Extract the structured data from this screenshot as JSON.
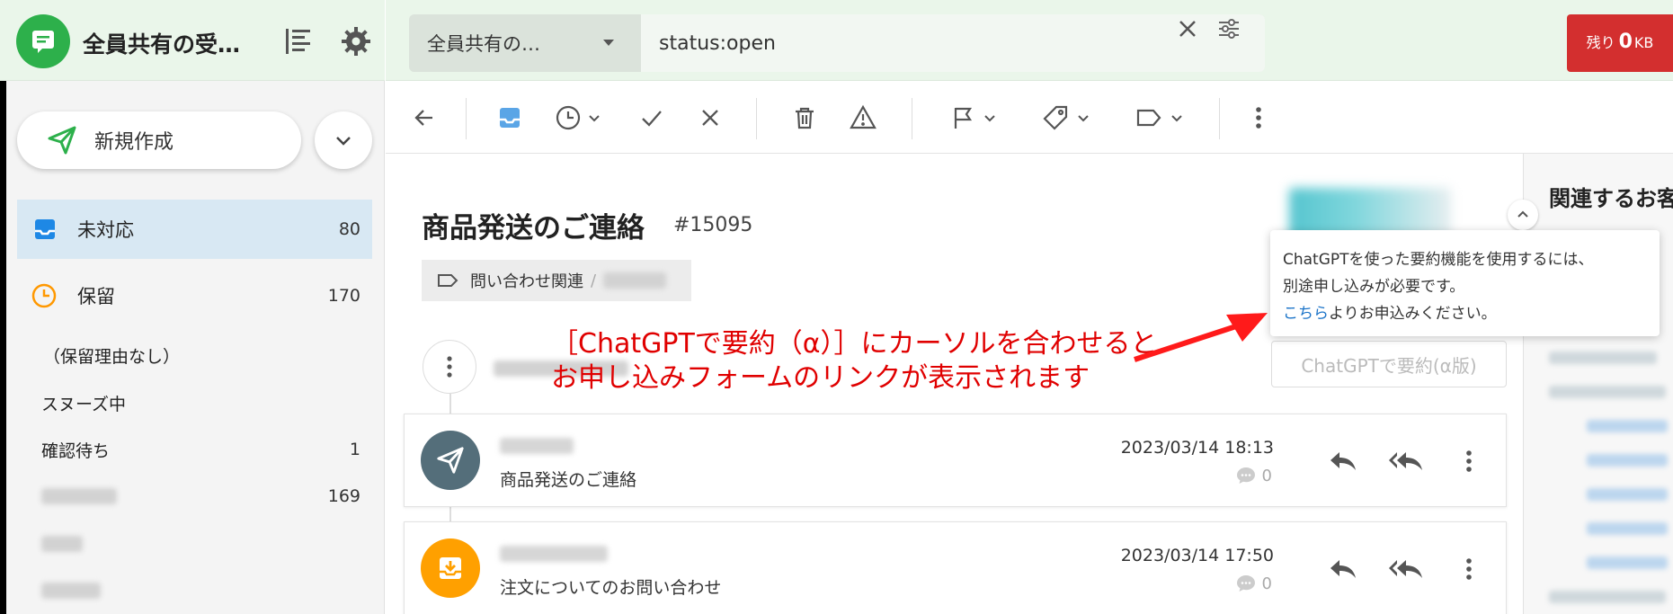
{
  "sidebar": {
    "workspace_title": "全員共有の受…",
    "compose_label": "新規作成",
    "nav": [
      {
        "label": "未対応",
        "count": "80"
      },
      {
        "label": "保留",
        "count": "170"
      }
    ],
    "sub": [
      {
        "label": "（保留理由なし）",
        "count": ""
      },
      {
        "label": "スヌーズ中",
        "count": ""
      },
      {
        "label": "確認待ち",
        "count": "1"
      },
      {
        "label": "",
        "count": "169"
      }
    ]
  },
  "topbar": {
    "scope_label": "全員共有の…",
    "search_value": "status:open",
    "quota_prefix": "残り",
    "quota_value": "0",
    "quota_unit": "KB"
  },
  "ticket": {
    "subject": "商品発送のご連絡",
    "id": "#15095",
    "tag": "問い合わせ関連",
    "tag_sep": "/",
    "summary_button": "ChatGPTで要約(α版)"
  },
  "messages": [
    {
      "subject": "商品発送のご連絡",
      "date": "2023/03/14 18:13",
      "comments": "0",
      "avatar_color": "#546e7a",
      "type": "sent"
    },
    {
      "subject": "注文についてのお問い合わせ",
      "date": "2023/03/14 17:50",
      "comments": "0",
      "avatar_color": "#ffa000",
      "type": "received"
    }
  ],
  "right_panel": {
    "title": "関連するお客"
  },
  "tooltip": {
    "line1": "ChatGPTを使った要約機能を使用するには、",
    "line2": "別途申し込みが必要です。",
    "link": "こちら",
    "line3_rest": "よりお申込みください。"
  },
  "annotation": {
    "line1": "［ChatGPTで要約（α）］にカーソルを合わせると",
    "line2": "お申し込みフォームのリンクが表示されます"
  },
  "colors": {
    "brand_green": "#2db04b",
    "header_bg": "#eaf6ea",
    "active_nav": "#d8e8f3",
    "primary_blue": "#1e88e5",
    "snooze_orange": "#ff9800",
    "quota_red": "#d32f2f",
    "annotation_red": "#e00000",
    "link_blue": "#1a73c8"
  }
}
